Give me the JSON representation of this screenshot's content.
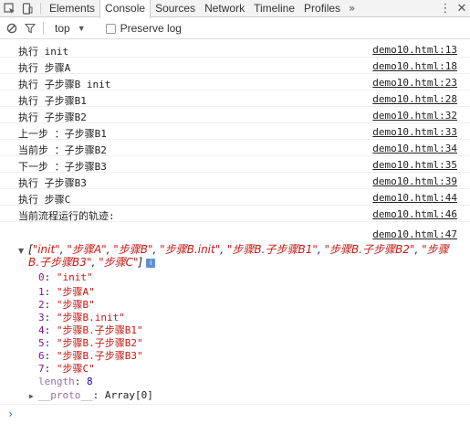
{
  "tabs": [
    {
      "label": "Elements",
      "active": false
    },
    {
      "label": "Console",
      "active": true
    },
    {
      "label": "Sources",
      "active": false
    },
    {
      "label": "Network",
      "active": false
    },
    {
      "label": "Timeline",
      "active": false
    },
    {
      "label": "Profiles",
      "active": false
    }
  ],
  "tab_overflow": "»",
  "toolbar": {
    "context": "top",
    "preserve_log": "Preserve log"
  },
  "messages": [
    {
      "text": "执行 init",
      "source": "demo10.html:13"
    },
    {
      "text": "执行 步骤A",
      "source": "demo10.html:18"
    },
    {
      "text": "执行 子步骤B init",
      "source": "demo10.html:23"
    },
    {
      "text": "执行 子步骤B1",
      "source": "demo10.html:28"
    },
    {
      "text": "执行 子步骤B2",
      "source": "demo10.html:32"
    },
    {
      "text": "上一步 ：子步骤B1",
      "source": "demo10.html:33"
    },
    {
      "text": "当前步 ：子步骤B2",
      "source": "demo10.html:34"
    },
    {
      "text": "下一步 ：子步骤B3",
      "source": "demo10.html:35"
    },
    {
      "text": "执行 子步骤B3",
      "source": "demo10.html:39"
    },
    {
      "text": "执行 步骤C",
      "source": "demo10.html:44"
    },
    {
      "text": "当前流程运行的轨迹:",
      "source": "demo10.html:46"
    }
  ],
  "array_log": {
    "source": "demo10.html:47",
    "preview_items": [
      "\"init\"",
      "\"步骤A\"",
      "\"步骤B\"",
      "\"步骤B.init\"",
      "\"步骤B.子步骤B1\"",
      "\"步骤B.子步骤B2\"",
      "\"步骤B.子步骤B3\"",
      "\"步骤C\""
    ],
    "info_icon": "i",
    "items": [
      {
        "key": "0",
        "value": "\"init\""
      },
      {
        "key": "1",
        "value": "\"步骤A\""
      },
      {
        "key": "2",
        "value": "\"步骤B\""
      },
      {
        "key": "3",
        "value": "\"步骤B.init\""
      },
      {
        "key": "4",
        "value": "\"步骤B.子步骤B1\""
      },
      {
        "key": "5",
        "value": "\"步骤B.子步骤B2\""
      },
      {
        "key": "6",
        "value": "\"步骤B.子步骤B3\""
      },
      {
        "key": "7",
        "value": "\"步骤C\""
      }
    ],
    "length_key": "length",
    "length_value": "8",
    "proto_key": "__proto__",
    "proto_value": "Array[0]"
  },
  "prompt_symbol": "›"
}
